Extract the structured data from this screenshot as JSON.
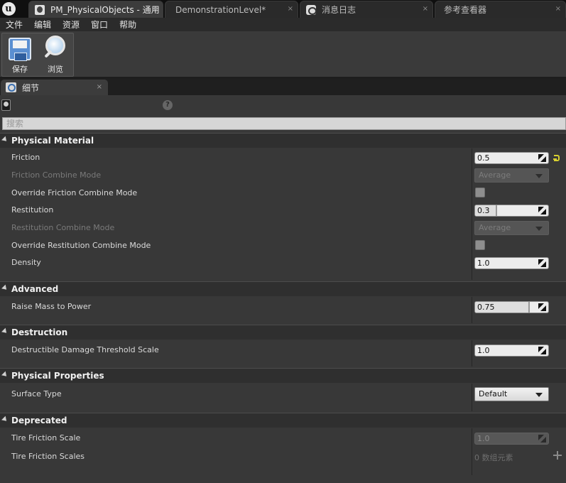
{
  "tabs": [
    {
      "label": "PM_PhysicalObjects - 通用",
      "close": "×"
    },
    {
      "label": "DemonstrationLevel*",
      "close": "×"
    },
    {
      "label": "消息日志",
      "close": "×"
    },
    {
      "label": "参考查看器",
      "close": "×"
    }
  ],
  "menu": [
    "文件",
    "编辑",
    "资源",
    "窗口",
    "帮助"
  ],
  "toolbar": {
    "save_label": "保存",
    "browse_label": "浏览"
  },
  "details_tab": {
    "label": "细节",
    "close": "×"
  },
  "search": {
    "placeholder": "搜索"
  },
  "help_glyph": "?",
  "categories": {
    "physical_material": {
      "title": "Physical Material",
      "rows": {
        "friction": {
          "label": "Friction",
          "value": "0.5"
        },
        "friction_combine_mode": {
          "label": "Friction Combine Mode",
          "value": "Average"
        },
        "override_friction": {
          "label": "Override Friction Combine Mode",
          "checked": false
        },
        "restitution": {
          "label": "Restitution",
          "value": "0.3",
          "fraction": 0.3
        },
        "restitution_combine_mode": {
          "label": "Restitution Combine Mode",
          "value": "Average"
        },
        "override_restitution": {
          "label": "Override Restitution Combine Mode",
          "checked": false
        },
        "density": {
          "label": "Density",
          "value": "1.0"
        }
      }
    },
    "advanced": {
      "title": "Advanced",
      "rows": {
        "raise_mass": {
          "label": "Raise Mass to Power",
          "value": "0.75",
          "fraction": 0.75
        }
      }
    },
    "destruction": {
      "title": "Destruction",
      "rows": {
        "damage_threshold": {
          "label": "Destructible Damage Threshold Scale",
          "value": "1.0"
        }
      }
    },
    "physical_properties": {
      "title": "Physical Properties",
      "rows": {
        "surface_type": {
          "label": "Surface Type",
          "value": "Default"
        }
      }
    },
    "deprecated": {
      "title": "Deprecated",
      "rows": {
        "tire_friction_scale": {
          "label": "Tire Friction Scale",
          "value": "1.0"
        },
        "tire_friction_scales": {
          "label": "Tire Friction Scales",
          "value": "0 数组元素"
        }
      }
    }
  }
}
